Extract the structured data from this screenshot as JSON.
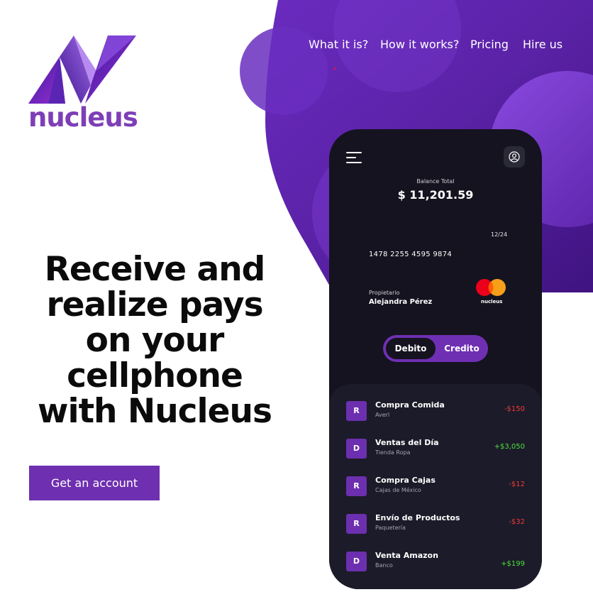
{
  "brand": {
    "name": "nucleus"
  },
  "nav": {
    "links": [
      "What it is?",
      "How it works?",
      "Pricing",
      "Hire us"
    ]
  },
  "hero": {
    "headline_lines": [
      "Receive and",
      "realize pays",
      "on your",
      "cellphone",
      "with Nucleus"
    ],
    "cta_label": "Get an account"
  },
  "phone": {
    "balance_label": "Balance Total",
    "balance_amount": "$ 11,201.59",
    "card": {
      "expiry": "12/24",
      "number": "1478 2255 4595 9874",
      "owner_label": "Propietario",
      "owner_name": "Alejandra Pérez",
      "brand": "nucleus"
    },
    "toggle": {
      "options": [
        "Debito",
        "Credito"
      ],
      "selected": "Debito"
    },
    "transactions": [
      {
        "badge": "R",
        "title": "Compra Comida",
        "subtitle": "Averl",
        "amount": "-$150",
        "type": "negative"
      },
      {
        "badge": "D",
        "title": "Ventas del Día",
        "subtitle": "Tienda Ropa",
        "amount": "+$3,050",
        "type": "positive"
      },
      {
        "badge": "R",
        "title": "Compra Cajas",
        "subtitle": "Cajas de México",
        "amount": "-$12",
        "type": "negative"
      },
      {
        "badge": "R",
        "title": "Envío de Productos",
        "subtitle": "Paquetería",
        "amount": "-$32",
        "type": "negative"
      },
      {
        "badge": "D",
        "title": "Venta Amazon",
        "subtitle": "Banco",
        "amount": "+$199",
        "type": "positive"
      }
    ]
  },
  "colors": {
    "brand_purple": "#6e2fb0",
    "negative": "#ef3b3b",
    "positive": "#4de03d",
    "phone_bg": "#14131f"
  }
}
